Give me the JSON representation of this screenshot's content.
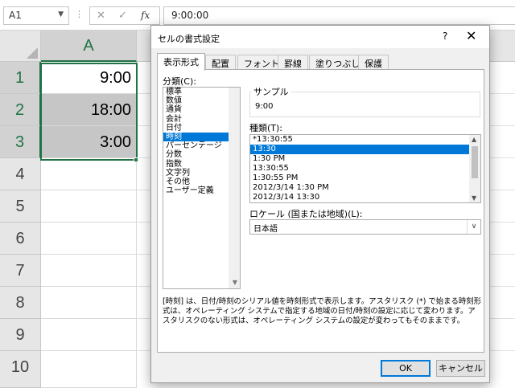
{
  "formula_bar": {
    "name_box": "A1",
    "cancel_icon": "✕",
    "enter_icon": "✓",
    "fx_label": "fx",
    "value": "9:00:00"
  },
  "sheet": {
    "column_header": "A",
    "rows": [
      "1",
      "2",
      "3",
      "4",
      "5",
      "6",
      "7",
      "8",
      "9",
      "10"
    ],
    "cells": [
      "9:00",
      "18:00",
      "3:00"
    ],
    "accent_color": "#217346",
    "selection_color": "#c6c6c6"
  },
  "dialog": {
    "title": "セルの書式設定",
    "help": "?",
    "close": "✕",
    "tabs": [
      "表示形式",
      "配置",
      "フォント",
      "罫線",
      "塗りつぶし",
      "保護"
    ],
    "active_tab": "表示形式",
    "category_label": "分類(C):",
    "categories": [
      "標準",
      "数値",
      "通貨",
      "会計",
      "日付",
      "時刻",
      "パーセンテージ",
      "分数",
      "指数",
      "文字列",
      "その他",
      "ユーザー定義"
    ],
    "selected_category": "時刻",
    "sample_label": "サンプル",
    "sample_value": "9:00",
    "type_label": "種類(T):",
    "types": [
      "*13:30:55",
      "13:30",
      "1:30 PM",
      "13:30:55",
      "1:30:55 PM",
      "2012/3/14 1:30 PM",
      "2012/3/14 13:30"
    ],
    "selected_type": "13:30",
    "locale_label": "ロケール (国または地域)(L):",
    "locale_value": "日本語",
    "description": "[時刻] は、日付/時刻のシリアル値を時刻形式で表示します。アスタリスク (*) で始まる時刻形式は、オペレーティング システムで指定する地域の日付/時刻の設定に応じて変わります。アスタリスクのない形式は、オペレーティング システムの設定が変わってもそのままです。",
    "ok_label": "OK",
    "cancel_label": "キャンセル",
    "selection_color": "#0078d7"
  }
}
